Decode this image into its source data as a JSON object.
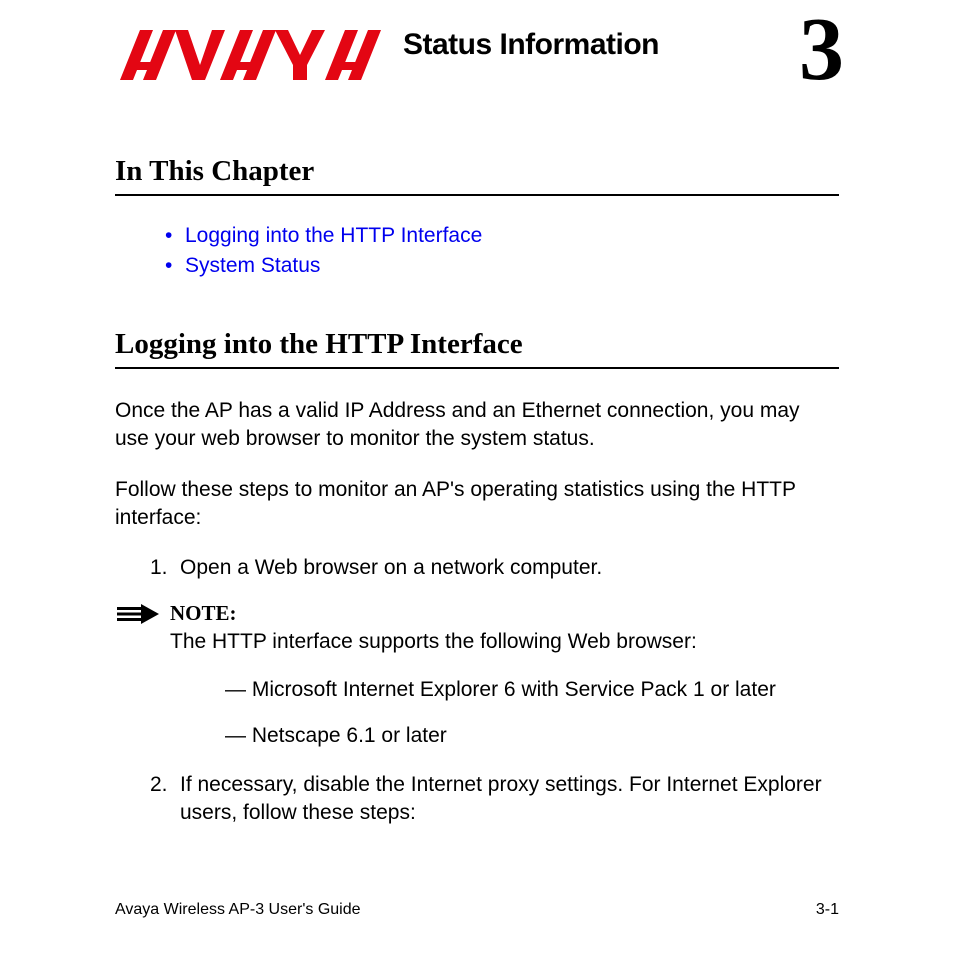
{
  "header": {
    "logo_text": "AVAYA",
    "chapter_title": "Status Information",
    "chapter_number": "3"
  },
  "sections": {
    "in_this_chapter": {
      "heading": "In This Chapter",
      "links": [
        "Logging into the HTTP Interface",
        "System Status"
      ]
    },
    "logging_http": {
      "heading": "Logging into the HTTP Interface",
      "para1": "Once the AP has a valid IP Address and an Ethernet connection, you may use your web browser to monitor the system status.",
      "para2": "Follow these steps to monitor an AP's operating statistics using the HTTP interface:",
      "steps": {
        "s1_num": "1.",
        "s1_text": "Open a Web browser on a network computer.",
        "s2_num": "2.",
        "s2_text": "If necessary, disable the Internet proxy settings. For Internet Explorer users, follow these steps:"
      },
      "note": {
        "label": "NOTE:",
        "text": "The HTTP interface supports the following Web browser:",
        "items": [
          "— Microsoft Internet Explorer 6 with Service Pack 1 or later",
          "— Netscape 6.1 or later"
        ]
      }
    }
  },
  "footer": {
    "left": "Avaya Wireless AP-3 User's Guide",
    "right": "3-1"
  }
}
